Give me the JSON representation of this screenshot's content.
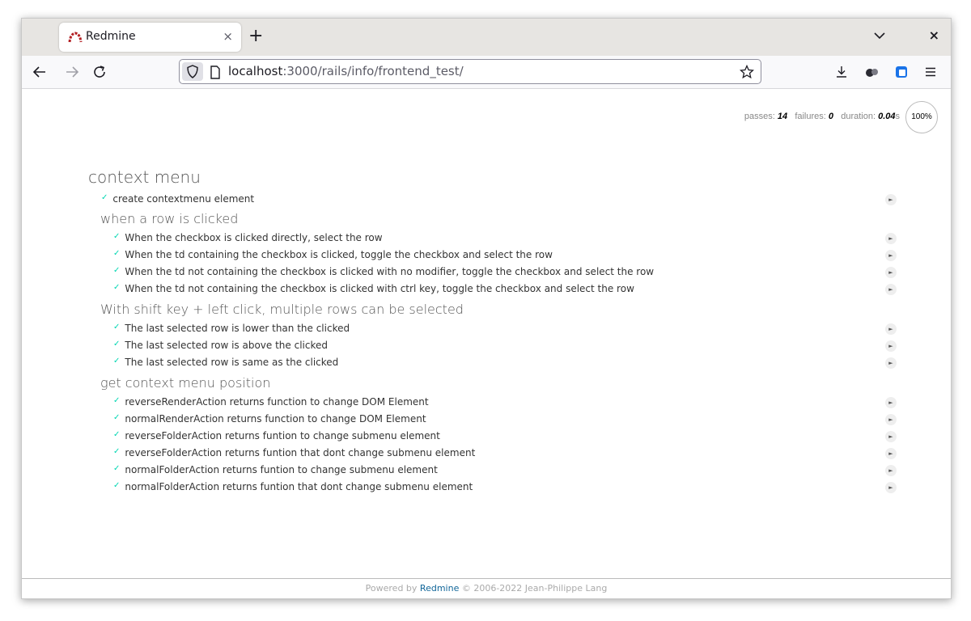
{
  "browser": {
    "tab_title": "Redmine",
    "tab_close": "×",
    "new_tab": "+",
    "window_close": "×",
    "url_host": "localhost",
    "url_rest": ":3000/rails/info/frontend_test/"
  },
  "stats": {
    "passes_label": "passes:",
    "passes": "14",
    "failures_label": "failures:",
    "failures": "0",
    "duration_label": "duration:",
    "duration": "0.04",
    "duration_unit": "s",
    "progress": "100%"
  },
  "suite": {
    "title": "context menu",
    "tests": [
      {
        "check": "✓",
        "title": "create contextmenu element",
        "replay": "►"
      }
    ],
    "suites": [
      {
        "title": "when a row is clicked",
        "tests": [
          {
            "check": "✓",
            "title": "When the checkbox is clicked directly, select the row",
            "replay": "►"
          },
          {
            "check": "✓",
            "title": "When the td containing the checkbox is clicked, toggle the checkbox and select the row",
            "replay": "►"
          },
          {
            "check": "✓",
            "title": "When the td not containing the checkbox is clicked with no modifier, toggle the checkbox and select the row",
            "replay": "►"
          },
          {
            "check": "✓",
            "title": "When the td not containing the checkbox is clicked with ctrl key, toggle the checkbox and select the row",
            "replay": "►"
          }
        ]
      },
      {
        "title": "With shift key + left click, multiple rows can be selected",
        "tests": [
          {
            "check": "✓",
            "title": "The last selected row is lower than the clicked",
            "replay": "►"
          },
          {
            "check": "✓",
            "title": "The last selected row is above the clicked",
            "replay": "►"
          },
          {
            "check": "✓",
            "title": "The last selected row is same as the clicked",
            "replay": "►"
          }
        ]
      },
      {
        "title": "get context menu position",
        "tests": [
          {
            "check": "✓",
            "title": "reverseRenderAction returns function to change DOM Element",
            "replay": "►"
          },
          {
            "check": "✓",
            "title": "normalRenderAction returns function to change DOM Element",
            "replay": "►"
          },
          {
            "check": "✓",
            "title": "reverseFolderAction returns funtion to change submenu element",
            "replay": "►"
          },
          {
            "check": "✓",
            "title": "reverseFolderAction returns funtion that dont change submenu element",
            "replay": "►"
          },
          {
            "check": "✓",
            "title": "normalFolderAction returns funtion to change submenu element",
            "replay": "►"
          },
          {
            "check": "✓",
            "title": "normalFolderAction returns funtion that dont change submenu element",
            "replay": "►"
          }
        ]
      }
    ]
  },
  "footer": {
    "prefix": "Powered by",
    "link": "Redmine",
    "suffix": "© 2006-2022 Jean-Philippe Lang"
  },
  "colors": {
    "check": "#00d6b2",
    "link": "#116699",
    "logo": "#b32024"
  }
}
